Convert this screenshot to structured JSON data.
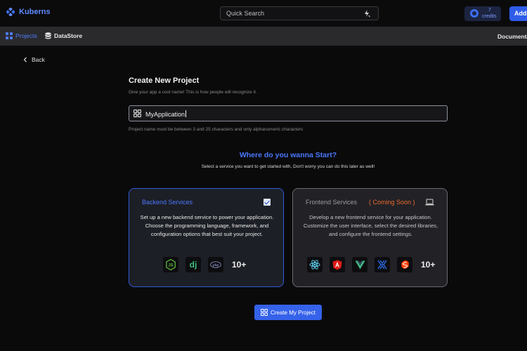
{
  "app": {
    "name": "Kuberns",
    "brand_color": "#5e8bff"
  },
  "header": {
    "search_placeholder": "Quick Search",
    "credits_count": "7",
    "credits_label": "credits",
    "add_label": "Add New"
  },
  "nav": {
    "items": [
      {
        "label": "Projects",
        "icon": "grid-icon",
        "active": true
      },
      {
        "label": "DataStore",
        "icon": "database-icon",
        "active": false
      }
    ],
    "docs_label": "Documentation"
  },
  "back_label": "Back",
  "form": {
    "title": "Create New Project",
    "subtitle": "Give your app a cool name! This is how people will recognize it.",
    "project_name": "MyApplication",
    "hint": "Project name must be between 3 and 25 characters and only alphanumeric characters"
  },
  "start": {
    "heading": "Where do you wanna Start?",
    "subheading": "Select a service you want to get started with, Don't worry you can do this later as well!"
  },
  "cards": {
    "backend": {
      "title": "Backend Services",
      "selected": true,
      "description": "Set up a new backend service to power your application. Choose the programming language, framework, and configuration options that best suit your project.",
      "tech_icons": [
        "nodejs-icon",
        "django-icon",
        "php-icon"
      ],
      "more": "10+"
    },
    "frontend": {
      "title": "Frontend Services",
      "badge": "( Coming Soon )",
      "description": "Develop a new frontend service for your application. Customize the user interface, select the desired libraries, and configure the frontend settings.",
      "tech_icons": [
        "react-icon",
        "angular-icon",
        "vue-icon",
        "webflow-icon",
        "svelte-icon"
      ],
      "more": "10+"
    }
  },
  "create_button": "Create My Project",
  "accent_color": "#3562ea",
  "warning_color": "#ec6a2c"
}
